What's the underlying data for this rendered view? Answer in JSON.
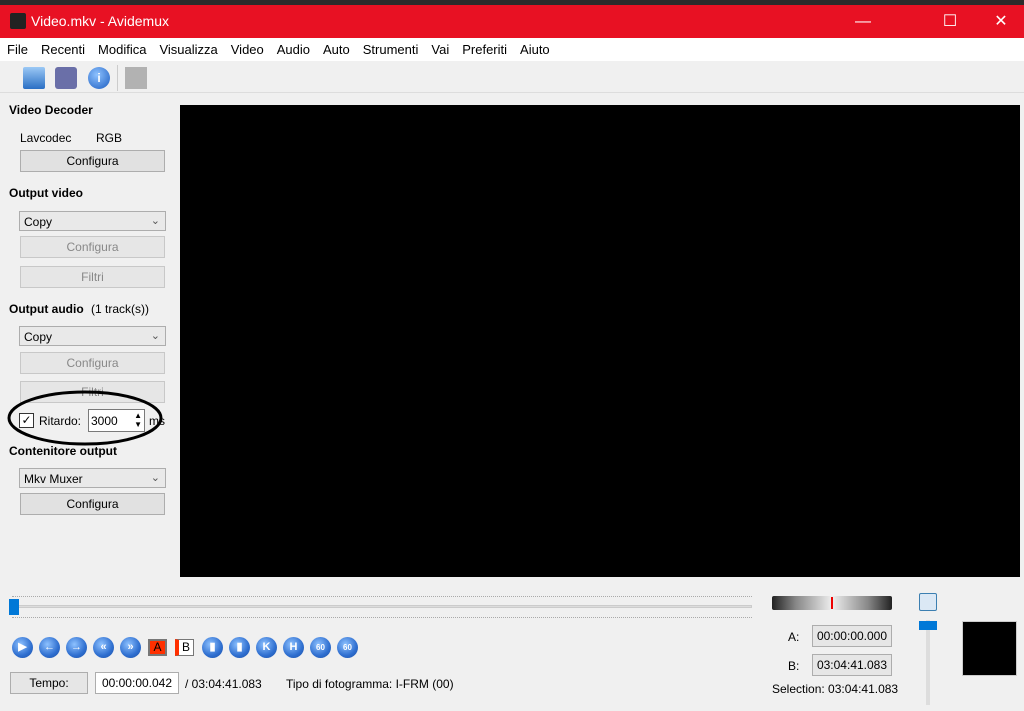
{
  "window": {
    "title": "Video.mkv - Avidemux",
    "minimize": "—",
    "maximize": "☐",
    "close": "✕"
  },
  "menu": [
    "File",
    "Recenti",
    "Modifica",
    "Visualizza",
    "Video",
    "Audio",
    "Auto",
    "Strumenti",
    "Vai",
    "Preferiti",
    "Aiuto"
  ],
  "toolbar": [
    "open-icon",
    "save-icon",
    "info-icon",
    "filter-icon"
  ],
  "video_decoder": {
    "title": "Video Decoder",
    "decoder": "Lavcodec",
    "format": "RGB",
    "configure": "Configura"
  },
  "output_video": {
    "title": "Output video",
    "codec": "Copy",
    "configure": "Configura",
    "filters": "Filtri"
  },
  "output_audio": {
    "title": "Output audio",
    "tracks": "(1 track(s))",
    "codec": "Copy",
    "configure": "Configura",
    "filters": "Filtri",
    "delay_checked": true,
    "delay_label": "Ritardo:",
    "delay_value": "3000",
    "delay_unit": "ms"
  },
  "container": {
    "title": "Contenitore output",
    "muxer": "Mkv Muxer",
    "configure": "Configura"
  },
  "timeline": {
    "position": 0.0
  },
  "controls": {
    "marker_a": "A",
    "marker_b": "B",
    "go60": "60"
  },
  "status": {
    "time_button": "Tempo:",
    "current_time": "00:00:00.042",
    "total_time": "/ 03:04:41.083",
    "frame_type": "Tipo di fotogramma:  I-FRM (00)"
  },
  "selection": {
    "a_label": "A:",
    "a_value": "00:00:00.000",
    "b_label": "B:",
    "b_value": "03:04:41.083",
    "selection": "Selection: 03:04:41.083"
  },
  "volume": {
    "level": 1.0
  }
}
